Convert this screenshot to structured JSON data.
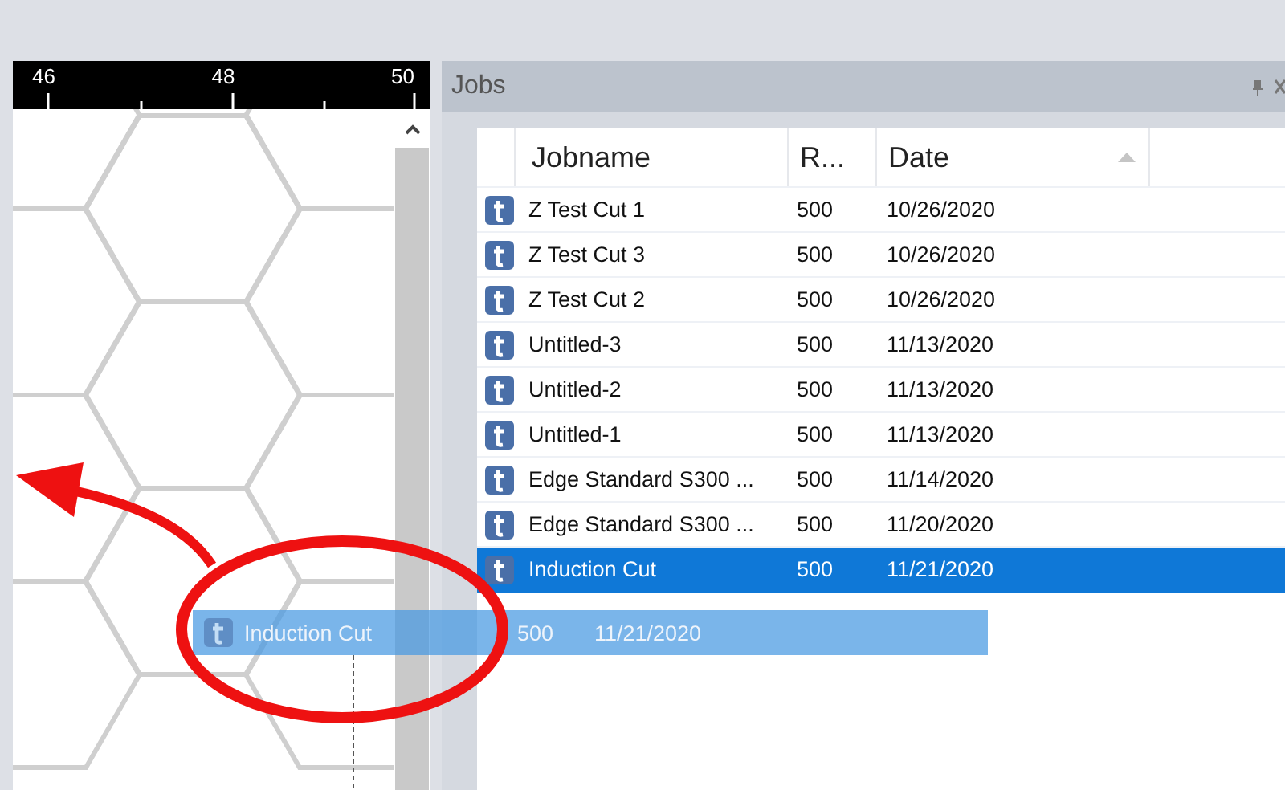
{
  "canvas": {
    "ruler_labels": [
      "46",
      "48",
      "50"
    ]
  },
  "jobs_panel": {
    "title": "Jobs",
    "columns": [
      {
        "label": "Jobname",
        "sorted": false
      },
      {
        "label": "R...",
        "sorted": false
      },
      {
        "label": "Date",
        "sorted": true
      }
    ],
    "rows": [
      {
        "name": "Z Test Cut 1",
        "column_2": "500",
        "date": "10/26/2020",
        "selected": false
      },
      {
        "name": "Z Test Cut 3",
        "column_2": "500",
        "date": "10/26/2020",
        "selected": false
      },
      {
        "name": "Z Test Cut 2",
        "column_2": "500",
        "date": "10/26/2020",
        "selected": false
      },
      {
        "name": "Untitled-3",
        "column_2": "500",
        "date": "11/13/2020",
        "selected": false
      },
      {
        "name": "Untitled-2",
        "column_2": "500",
        "date": "11/13/2020",
        "selected": false
      },
      {
        "name": "Untitled-1",
        "column_2": "500",
        "date": "11/13/2020",
        "selected": false
      },
      {
        "name": "Edge Standard S300 ...",
        "column_2": "500",
        "date": "11/14/2020",
        "selected": false
      },
      {
        "name": "Edge Standard S300 ...",
        "column_2": "500",
        "date": "11/20/2020",
        "selected": false
      },
      {
        "name": "Induction Cut",
        "column_2": "500",
        "date": "11/21/2020",
        "selected": true
      }
    ]
  },
  "drag_ghost": {
    "name": "Induction Cut",
    "column_2": "500",
    "date": "11/21/2020"
  }
}
